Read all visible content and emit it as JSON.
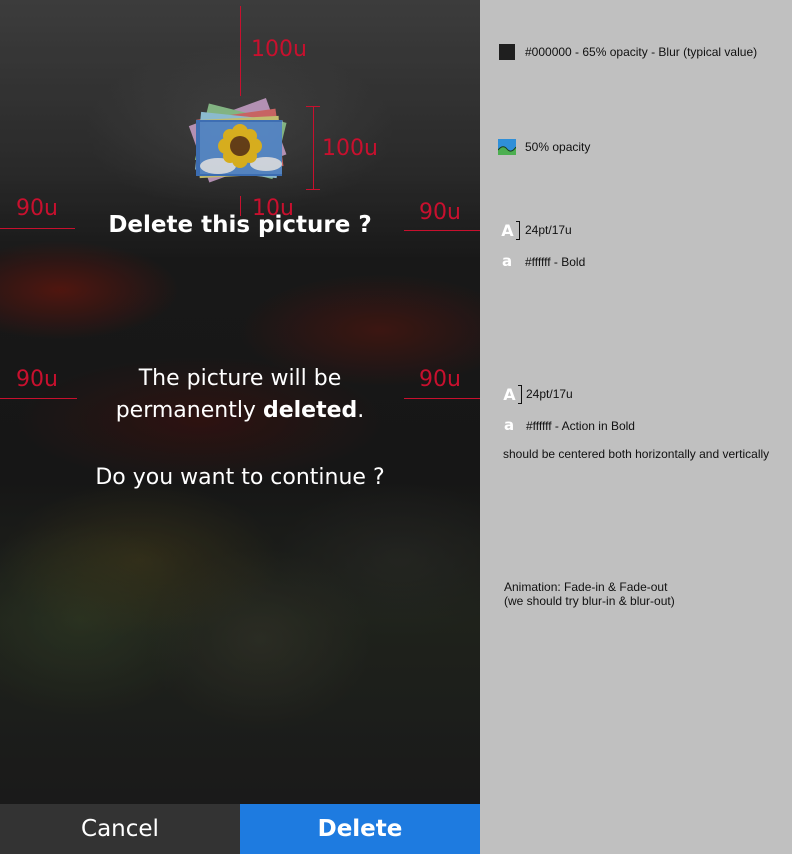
{
  "dialog": {
    "title": "Delete this picture ?",
    "body_line1": "The picture will be",
    "body_line2_prefix": "permanently ",
    "body_line2_bold": "deleted",
    "body_line2_suffix": ".",
    "question": "Do you want to continue ?"
  },
  "buttons": {
    "cancel_label": "Cancel",
    "delete_label": "Delete"
  },
  "measurements": {
    "top_spacing": "100u",
    "icon_size": "100u",
    "icon_title_gap": "10u",
    "title_margin_left": "90u",
    "title_margin_right": "90u",
    "body_margin_left": "90u",
    "body_margin_right": "90u"
  },
  "notes": {
    "overlay_spec": "#000000 - 65% opacity - Blur (typical value)",
    "icon_opacity": "50% opacity",
    "title_size": "24pt/17u",
    "title_style": "#ffffff - Bold",
    "body_size": "24pt/17u",
    "body_style": "#ffffff - Action in Bold",
    "body_alignment": "should be centered both horizontally and vertically",
    "animation_line1": "Animation: Fade-in & Fade-out",
    "animation_line2": "(we should try blur-in & blur-out)"
  },
  "colors": {
    "annotation_red": "#c8102e",
    "delete_button_bg": "#1e7be0",
    "cancel_button_bg": "#333333",
    "notes_bg": "#c0c0c0",
    "text_white": "#ffffff"
  },
  "icons": {
    "stack": "photo-stack-icon",
    "swatch_black": "black-swatch-icon",
    "swatch_image": "image-thumbnail-icon",
    "font_size": "font-size-glyph-icon",
    "font_style": "font-style-glyph-icon"
  }
}
